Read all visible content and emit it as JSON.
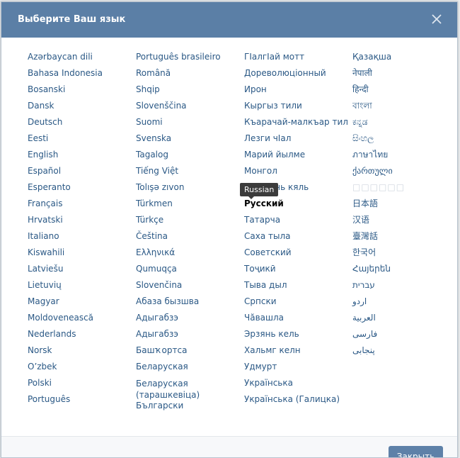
{
  "dialog": {
    "title": "Выберите Ваш язык",
    "close_button_label": "Закрыть"
  },
  "tooltip": "Russian",
  "current_language": "Русский",
  "columns": [
    [
      "Azərbaycan dili",
      "Bahasa Indonesia",
      "Bosanski",
      "Dansk",
      "Deutsch",
      "Eesti",
      "English",
      "Español",
      "Esperanto",
      "Français",
      "Hrvatski",
      "Italiano",
      "Kiswahili",
      "Latviešu",
      "Lietuvių",
      "Magyar",
      "Moldovenească",
      "Nederlands",
      "Norsk",
      "O’zbek",
      "Polski",
      "Português"
    ],
    [
      "Português brasileiro",
      "Română",
      "Shqip",
      "Slovenščina",
      "Suomi",
      "Svenska",
      "Tagalog",
      "Tiếng Việt",
      "Tolışə zıvon",
      "Türkmen",
      "Türkçe",
      "Čeština",
      "Ελληνικά",
      "Qumuqça",
      "Slovenčina",
      "Абаза бызшва",
      "Адыгабзэ",
      "Адыгабзэ",
      "Башҡортса",
      "Беларуская",
      "Беларуская (тарашкевіца)",
      "Български"
    ],
    [
      "ГIалгIай мотт",
      "Дореволюціонный",
      "Ирон",
      "Кыргыз тили",
      "Къарачай-малкъар тил",
      "Лезги чІал",
      "Марий йылме",
      "Монгол",
      "Мокшень кяль",
      "Русский",
      "Татарча",
      "Саха тыла",
      "Советский",
      "Тоҷикӣ",
      "Тыва дыл",
      "Српски",
      "Чӑвашла",
      "Эрзянь кель",
      "Хальмг келн",
      "Удмурт",
      "Українська",
      "Українська (Галицка)"
    ],
    [
      "Қазақша",
      "नेपाली",
      "हिन्दी",
      "বাংলা",
      "ಕನ್ನಡ",
      "සිංහල",
      "ภาษาไทย",
      "ქართული",
      "□□□□□□",
      "日本語",
      "汉语",
      "臺灣話",
      "한국어",
      "Հայերեն",
      "עברית",
      "اردو",
      "العربية",
      "فارسی",
      "پنجابی"
    ]
  ],
  "colors": {
    "header_bg": "#5b7fa6",
    "link": "#2a5885",
    "button_bg": "#5e81a8"
  },
  "icons": {
    "close": "close-icon"
  }
}
